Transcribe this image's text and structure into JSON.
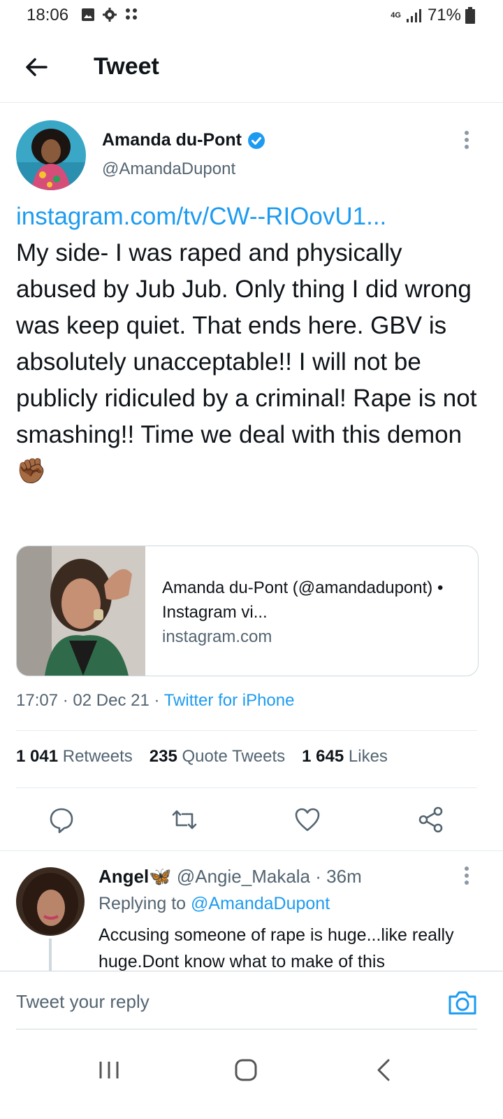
{
  "status_bar": {
    "time": "18:06",
    "network": "4G",
    "battery": "71%"
  },
  "header": {
    "title": "Tweet"
  },
  "tweet": {
    "author_name": "Amanda du-Pont",
    "author_handle": "@AmandaDupont",
    "link": "instagram.com/tv/CW--RIOovU1...",
    "text": "My side- I was raped and physically abused by Jub Jub. Only thing I did wrong was keep quiet. That ends here. GBV is absolutely unacceptable!! I will not be publicly ridiculed by a criminal! Rape is not smashing!! Time we deal with this demon✊🏾",
    "card": {
      "title": "Amanda du-Pont (@amandadupont) • Instagram vi...",
      "domain": "instagram.com"
    },
    "time": "17:07",
    "date": "02 Dec 21",
    "source": "Twitter for iPhone",
    "dot": "·",
    "stats": {
      "retweets": "1 041",
      "retweets_label": "Retweets",
      "quotes": "235",
      "quotes_label": "Quote Tweets",
      "likes": "1 645",
      "likes_label": "Likes"
    }
  },
  "reply": {
    "name": "Angel🦋",
    "handle": "@Angie_Makala",
    "age": "36m",
    "replying_prefix": "Replying to",
    "replying_to": "@AmandaDupont",
    "text": "Accusing someone of rape is huge...like really huge.Dont know what to make of this"
  },
  "compose": {
    "placeholder": "Tweet your reply"
  },
  "colors": {
    "accent": "#1d9bf0",
    "text": "#0f1419",
    "secondary": "#536471"
  }
}
